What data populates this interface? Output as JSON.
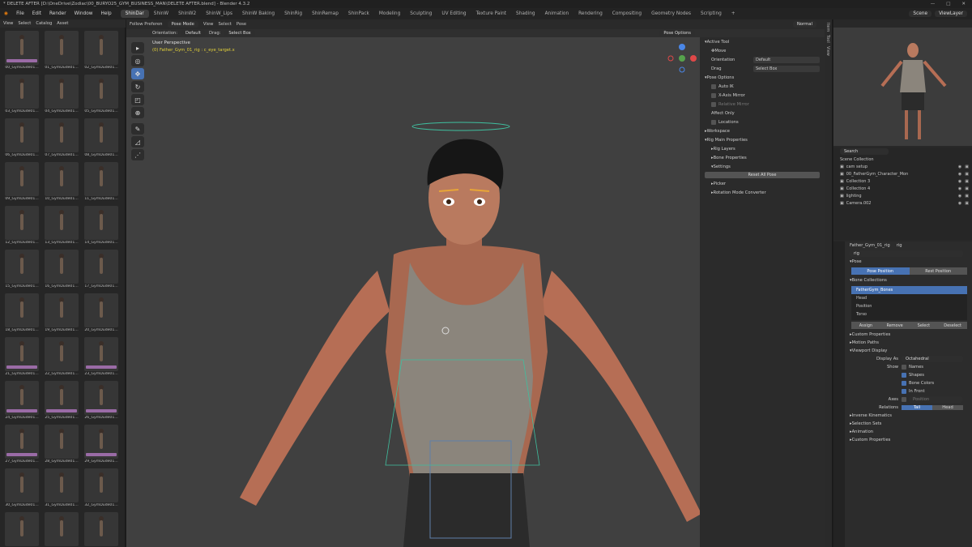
{
  "window": {
    "title": "* DELETE AFTER [D:\\OneDrive\\Zodiac\\00_BURYO25_GYM_BUSINESS_MAN\\DELETE AFTER.blend] - Blender 4.3.2",
    "min": "—",
    "max": "□",
    "close": "✕"
  },
  "menus": [
    "File",
    "Edit",
    "Render",
    "Window",
    "Help"
  ],
  "workspaces": [
    "ShinDar",
    "ShinW",
    "ShinW2",
    "ShinW_Lips",
    "ShinW Baking",
    "ShinRig",
    "ShinRemap",
    "ShinPack",
    "Modeling",
    "Sculpting",
    "UV Editing",
    "Texture Paint",
    "Shading",
    "Animation",
    "Rendering",
    "Compositing",
    "Geometry Nodes",
    "Scripting",
    "+"
  ],
  "active_workspace": "ShinDar",
  "topright": {
    "scene_label": "Scene",
    "viewlayer_label": "ViewLayer"
  },
  "asset_browser": {
    "header": [
      "View",
      "Select",
      "Catalog",
      "Asset"
    ],
    "thumbnails": [
      {
        "label": "00_GymDude01...",
        "mat": true
      },
      {
        "label": "01_GymDude01...",
        "mat": false
      },
      {
        "label": "02_GymDude01...",
        "mat": false
      },
      {
        "label": "03_GymDude01...",
        "mat": false
      },
      {
        "label": "04_GymDude01...",
        "mat": false
      },
      {
        "label": "05_GymDude01...",
        "mat": false
      },
      {
        "label": "06_GymDude01...",
        "mat": false
      },
      {
        "label": "07_GymDude01...",
        "mat": false
      },
      {
        "label": "08_GymDude01...",
        "mat": false
      },
      {
        "label": "09_GymDude01...",
        "mat": false
      },
      {
        "label": "10_GymDude01...",
        "mat": false
      },
      {
        "label": "11_GymDude01...",
        "mat": false
      },
      {
        "label": "12_GymDude01...",
        "mat": false
      },
      {
        "label": "13_GymDude01...",
        "mat": false
      },
      {
        "label": "14_GymDude01...",
        "mat": false
      },
      {
        "label": "15_GymDude01...",
        "mat": false
      },
      {
        "label": "16_GymDude01...",
        "mat": false
      },
      {
        "label": "17_GymDude01...",
        "mat": false
      },
      {
        "label": "18_GymDude01...",
        "mat": false
      },
      {
        "label": "19_GymDude01...",
        "mat": false
      },
      {
        "label": "20_GymDude01...",
        "mat": false
      },
      {
        "label": "21_GymDude01...",
        "mat": true
      },
      {
        "label": "22_GymDude01...",
        "mat": false
      },
      {
        "label": "23_GymDude01...",
        "mat": true
      },
      {
        "label": "24_GymDude01...",
        "mat": true
      },
      {
        "label": "25_GymDude01...",
        "mat": true
      },
      {
        "label": "26_GymDude01...",
        "mat": true
      },
      {
        "label": "27_GymDude01...",
        "mat": true
      },
      {
        "label": "28_GymDude01...",
        "mat": false
      },
      {
        "label": "29_GymDude01...",
        "mat": true
      },
      {
        "label": "30_GymDude01...",
        "mat": false
      },
      {
        "label": "31_GymDude01...",
        "mat": false
      },
      {
        "label": "32_GymDude01...",
        "mat": false
      },
      {
        "label": "",
        "mat": false
      },
      {
        "label": "",
        "mat": false
      },
      {
        "label": "",
        "mat": false
      }
    ]
  },
  "viewport": {
    "header": {
      "follow": "Follow Preferen",
      "mode": "Pose Mode",
      "view": "View",
      "select": "Select",
      "pose": "Pose",
      "shading": "Normal"
    },
    "toolheader": {
      "orientation_label": "Orientation:",
      "orientation": "Default",
      "drag_label": "Drag:",
      "drag": "Select Box",
      "options": "Pose Options"
    },
    "overlay_title": "User Perspective",
    "overlay_object": "(0) Father_Gym_01_rig : c_eye_target.x"
  },
  "npanel": {
    "active_tool": "Active Tool",
    "move": "Move",
    "orientation_label": "Orientation",
    "orientation": "Default",
    "drag_label": "Drag",
    "drag": "Select Box",
    "pose_options": "Pose Options",
    "auto_ik": "Auto IK",
    "x_axis_mirror": "X-Axis Mirror",
    "relative_mirror": "Relative Mirror",
    "affect_only": "Affect Only",
    "locations": "Locations",
    "workspace": "Workspace",
    "rig_main": "Rig Main Properties",
    "rig_layers": "Rig Layers",
    "bone_properties": "Bone Properties",
    "settings": "Settings",
    "reset_all_pose": "Reset All Pose",
    "picker": "Picker",
    "rotation_mode": "Rotation Mode Converter",
    "tabs": [
      "Item",
      "Tool",
      "View"
    ]
  },
  "outliner": {
    "search_placeholder": "Search",
    "root": "Scene Collection",
    "rows": [
      "cam setup",
      "00_FatherGym_Character_Mon",
      "Collection 3",
      "Collection 4",
      "lighting",
      "Camera.002"
    ]
  },
  "properties": {
    "object": "Father_Gym_01_rig",
    "rig": "rig",
    "search_value": "rig",
    "pose": "Pose",
    "pose_position": "Pose Position",
    "rest_position": "Rest Position",
    "bone_collections": "Bone Collections",
    "collections": [
      "FatherGym_Bones",
      "Head",
      "Position",
      "Torso"
    ],
    "assign": "Assign",
    "remove": "Remove",
    "select": "Select",
    "deselect": "Deselect",
    "custom_properties": "Custom Properties",
    "motion_paths": "Motion Paths",
    "viewport_display": "Viewport Display",
    "display_as_label": "Display As",
    "display_as": "Octahedral",
    "show_label": "Show",
    "names": "Names",
    "shapes": "Shapes",
    "bone_colors": "Bone Colors",
    "in_front": "In Front",
    "axes_label": "Axes",
    "position": "Position",
    "relations_label": "Relations",
    "tail": "Tail",
    "head": "Head",
    "ik": "Inverse Kinematics",
    "selection_sets": "Selection Sets",
    "animation": "Animation",
    "custom_properties2": "Custom Properties"
  },
  "colors": {
    "accent": "#4772b3",
    "yellow": "#e3d13a"
  }
}
